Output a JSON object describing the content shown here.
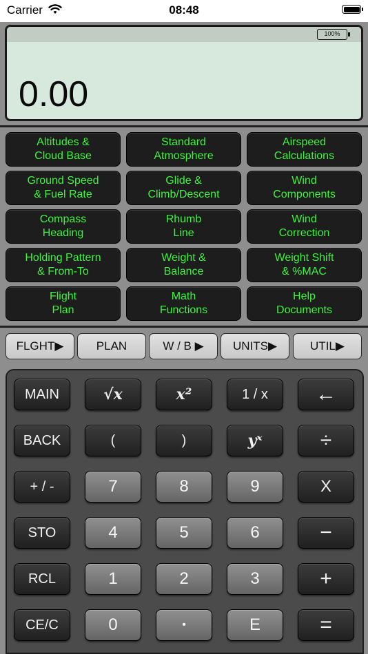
{
  "status_bar": {
    "carrier": "Carrier",
    "time": "08:48"
  },
  "display": {
    "battery": "100%",
    "value": "0.00"
  },
  "functions": [
    "Altitudes &\nCloud Base",
    "Standard\nAtmosphere",
    "Airspeed\nCalculations",
    "Ground Speed\n& Fuel Rate",
    "Glide &\nClimb/Descent",
    "Wind\nComponents",
    "Compass\nHeading",
    "Rhumb\nLine",
    "Wind\nCorrection",
    "Holding Pattern\n& From-To",
    "Weight &\nBalance",
    "Weight Shift\n& %MAC",
    "Flight\nPlan",
    "Math\nFunctions",
    "Help\nDocuments"
  ],
  "tabs": [
    "FLGHT▶",
    "PLAN",
    "W / B ▶",
    "UNITS▶",
    "UTIL▶"
  ],
  "keys": {
    "main": "MAIN",
    "sqrt": "√x",
    "square": "x²",
    "reciprocal": "1 / x",
    "backspace": "←",
    "back": "BACK",
    "lparen": "(",
    "rparen": ")",
    "power": "yˣ",
    "divide": "÷",
    "negate": "+ / -",
    "k7": "7",
    "k8": "8",
    "k9": "9",
    "multiply": "X",
    "sto": "STO",
    "k4": "4",
    "k5": "5",
    "k6": "6",
    "minus": "−",
    "rcl": "RCL",
    "k1": "1",
    "k2": "2",
    "k3": "3",
    "plus": "+",
    "clear": "CE/C",
    "k0": "0",
    "decimal": "•",
    "exp": "E",
    "equals": "="
  },
  "colors": {
    "function_text": "#3bf53b",
    "display_bg": "#d7e8dd",
    "keypad_bg": "#4b4b4b"
  }
}
